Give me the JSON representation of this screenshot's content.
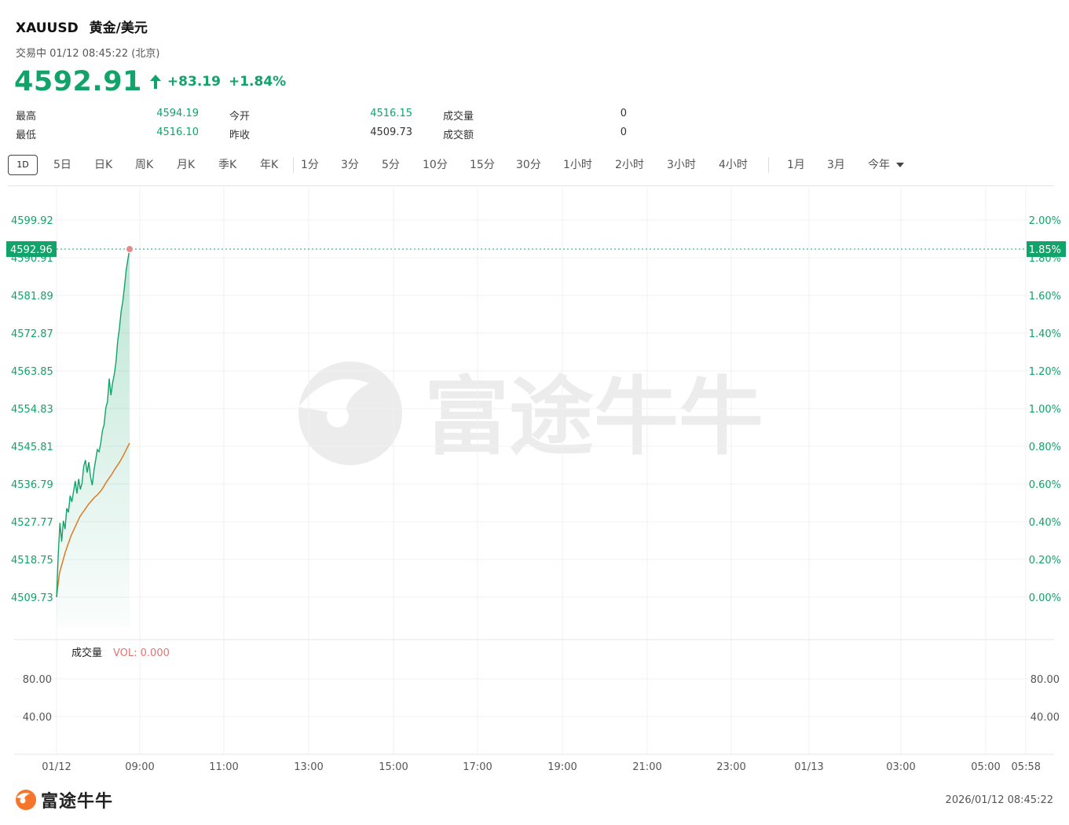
{
  "header": {
    "symbol": "XAUUSD",
    "name": "黄金/美元",
    "status": "交易中 01/12 08:45:22 (北京)",
    "price": "4592.91",
    "change": "+83.19",
    "change_pct": "+1.84%",
    "up_color": "#12a36b"
  },
  "stats": {
    "high_label": "最高",
    "high": "4594.19",
    "low_label": "最低",
    "low": "4516.10",
    "open_label": "今开",
    "open": "4516.15",
    "prev_label": "昨收",
    "prev": "4509.73",
    "vol_label": "成交量",
    "vol": "0",
    "amt_label": "成交额",
    "amt": "0"
  },
  "tabs": [
    "1D",
    "5日",
    "日K",
    "周K",
    "月K",
    "季K",
    "年K",
    "1分",
    "3分",
    "5分",
    "10分",
    "15分",
    "30分",
    "1小时",
    "2小时",
    "3小时",
    "4小时",
    "1月",
    "3月",
    "今年"
  ],
  "chart_data": {
    "type": "line",
    "y_ticks": [
      "4599.92",
      "4590.91",
      "4581.89",
      "4572.87",
      "4563.85",
      "4554.83",
      "4545.81",
      "4536.79",
      "4527.77",
      "4518.75",
      "4509.73"
    ],
    "y_right_ticks": [
      "2.00%",
      "1.80%",
      "1.60%",
      "1.40%",
      "1.20%",
      "1.00%",
      "0.80%",
      "0.60%",
      "0.40%",
      "0.20%",
      "0.00%"
    ],
    "ylim": [
      4509.73,
      4599.92
    ],
    "x_ticks": [
      "01/12",
      "09:00",
      "11:00",
      "13:00",
      "15:00",
      "17:00",
      "19:00",
      "21:00",
      "23:00",
      "01/13",
      "03:00",
      "05:00",
      "05:58"
    ],
    "current_price_label": "4592.96",
    "current_pct_label": "1.85%",
    "series": [
      {
        "color": "#12a36b",
        "x_minutes": [
          0,
          1,
          2,
          3,
          4,
          5,
          6,
          7,
          8,
          9,
          10,
          11,
          12,
          13,
          14,
          15,
          16,
          17,
          18,
          19,
          20,
          21,
          22,
          23,
          24,
          25,
          26,
          27,
          28,
          29,
          30,
          31,
          32,
          33,
          34,
          35,
          36,
          37,
          38,
          39,
          40,
          41,
          42,
          43,
          44,
          45,
          46,
          47,
          48,
          49,
          50,
          51,
          52
        ],
        "values": [
          4509.73,
          4520.0,
          4527.5,
          4523.0,
          4528.0,
          4526.0,
          4531.0,
          4530.0,
          4534.0,
          4532.5,
          4535.0,
          4537.5,
          4534.5,
          4538.0,
          4535.5,
          4537.0,
          4541.0,
          4542.5,
          4539.5,
          4542.0,
          4538.5,
          4536.5,
          4540.0,
          4542.5,
          4545.0,
          4544.5,
          4546.5,
          4549.5,
          4551.0,
          4555.0,
          4556.5,
          4562.0,
          4558.0,
          4561.0,
          4563.0,
          4566.0,
          4571.0,
          4574.0,
          4578.0,
          4580.5,
          4584.0,
          4588.0,
          4590.5,
          4592.96
        ]
      },
      {
        "color": "#e07a1f",
        "x_minutes": [
          0,
          1,
          2,
          4,
          6,
          8,
          10,
          12,
          14,
          16,
          18,
          20,
          22,
          24,
          26,
          28,
          30,
          32,
          34,
          36,
          38,
          40,
          42,
          44,
          46,
          48,
          50,
          52
        ],
        "values": [
          4509.73,
          4515.5,
          4518.0,
          4520.5,
          4522.5,
          4524.5,
          4526.0,
          4527.5,
          4529.0,
          4530.0,
          4531.0,
          4532.0,
          4532.8,
          4533.6,
          4534.2,
          4535.0,
          4536.0,
          4537.2,
          4538.2,
          4539.2,
          4540.4,
          4541.4,
          4542.5,
          4543.8,
          4545.2,
          4546.6
        ]
      }
    ],
    "volume": {
      "label": "成交量",
      "value_text": "VOL: 0.000",
      "y_ticks": [
        "80.00",
        "40.00"
      ],
      "ylim": [
        0,
        100
      ],
      "values": []
    }
  },
  "footer": {
    "brand": "富途牛牛",
    "timestamp": "2026/01/12 08:45:22"
  },
  "watermark": "富途牛牛"
}
